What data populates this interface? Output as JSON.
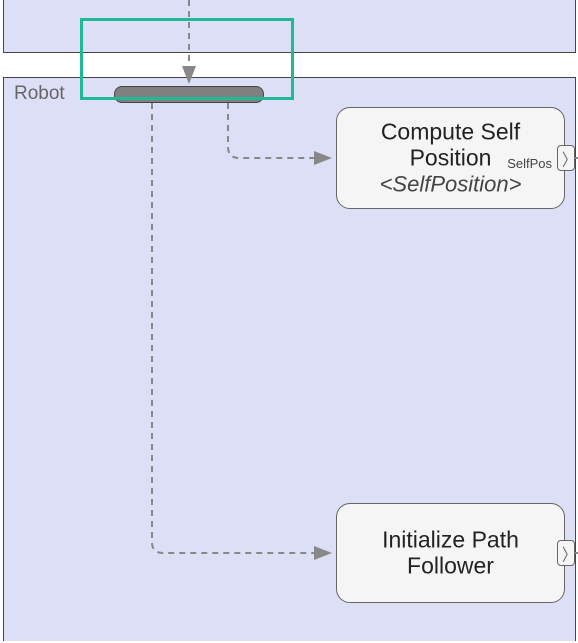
{
  "diagram": {
    "region_label": "Robot",
    "highlight_color": "#1fb996",
    "nodes": {
      "compute": {
        "title_line1": "Compute Self",
        "title_line2": "Position",
        "subtitle": "<SelfPosition>",
        "port_label": "SelfPos",
        "port_glyph": "〉"
      },
      "init": {
        "title_line1": "Initialize Path",
        "title_line2": "Follower",
        "port_glyph": "〉"
      }
    }
  }
}
